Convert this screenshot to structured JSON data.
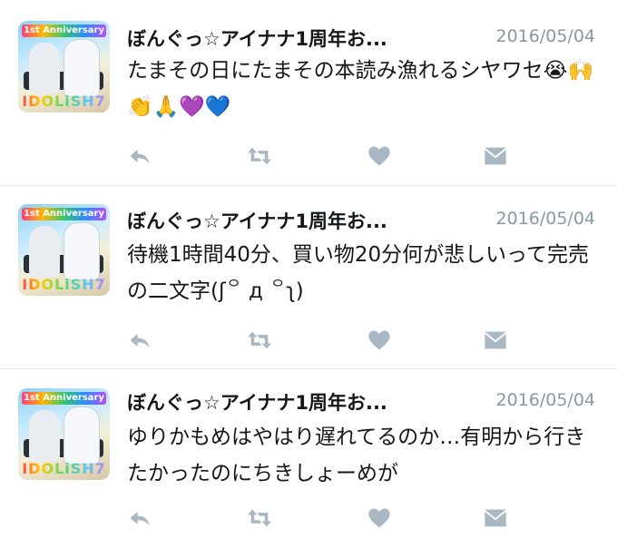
{
  "tweets": [
    {
      "name": "ぼんぐっ☆アイナナ1周年お...",
      "date": "2016/05/04",
      "text": "たまその日にたまその本読み漁れるシヤワセ😭🙌👏🙏💜💙",
      "avatar_text": "IDOLiSH7",
      "avatar_banner": "1st Anniversary"
    },
    {
      "name": "ぼんぐっ☆アイナナ1周年お...",
      "date": "2016/05/04",
      "text": "待機1時間40分、買い物20分何が悲しいって完売の二文字(ʃ꒪ д ꒪ʅ)",
      "avatar_text": "IDOLiSH7",
      "avatar_banner": "1st Anniversary"
    },
    {
      "name": "ぼんぐっ☆アイナナ1周年お...",
      "date": "2016/05/04",
      "text": "ゆりかもめはやはり遅れてるのか…有明から行きたかったのにちきしょーめが",
      "avatar_text": "IDOLiSH7",
      "avatar_banner": "1st Anniversary"
    }
  ],
  "icons": {
    "reply": "reply-icon",
    "retweet": "retweet-icon",
    "like": "heart-icon",
    "message": "envelope-icon"
  },
  "colors": {
    "icon": "#a9b7c3",
    "date": "#8899a6",
    "divider": "#e1e8ed"
  }
}
